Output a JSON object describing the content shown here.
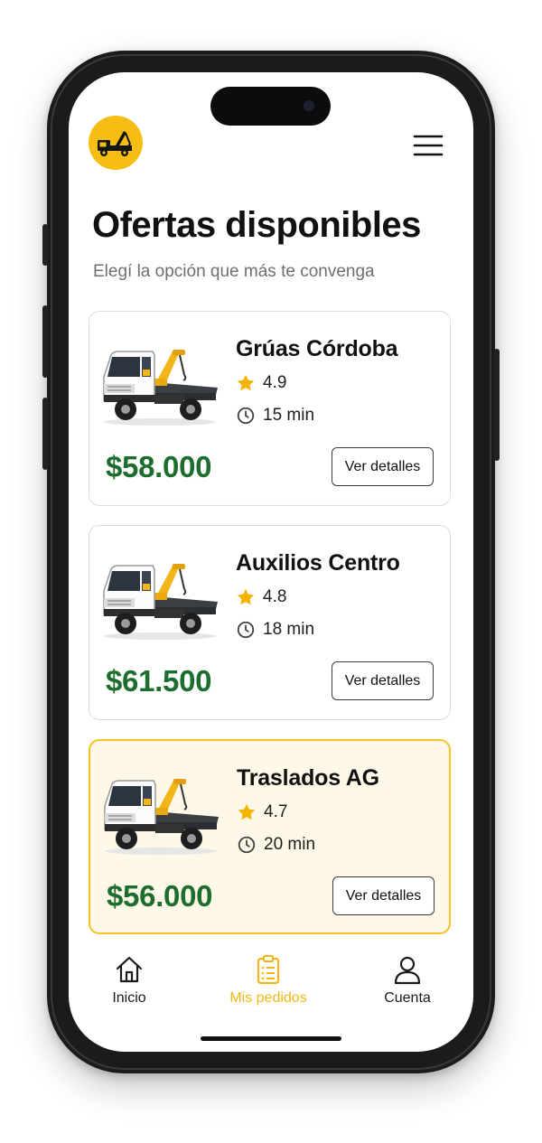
{
  "header": {
    "title": "Ofertas disponibles",
    "subtitle": "Elegí la opción que más te convenga"
  },
  "offers": [
    {
      "company": "Grúas Córdoba",
      "rating": "4.9",
      "eta": "15 min",
      "price": "$58.000",
      "button": "Ver detalles",
      "highlighted": false
    },
    {
      "company": "Auxilios Centro",
      "rating": "4.8",
      "eta": "18 min",
      "price": "$61.500",
      "button": "Ver detalles",
      "highlighted": false
    },
    {
      "company": "Traslados AG",
      "rating": "4.7",
      "eta": "20 min",
      "price": "$56.000",
      "button": "Ver detalles",
      "highlighted": true
    }
  ],
  "nav": {
    "items": [
      {
        "label": "Inicio",
        "icon": "home-icon",
        "active": false
      },
      {
        "label": "Mis pedidos",
        "icon": "clipboard-icon",
        "active": true
      },
      {
        "label": "Cuenta",
        "icon": "user-icon",
        "active": false
      }
    ]
  },
  "colors": {
    "accent": "#f6bd14",
    "price": "#1d6e2e",
    "star": "#f5b301",
    "highlight_bg": "#fdf8e7",
    "highlight_border": "#f3c224"
  },
  "icons": {
    "logo": "tow-truck-icon",
    "menu": "hamburger-menu-icon",
    "rating": "star-icon",
    "eta": "clock-icon"
  }
}
